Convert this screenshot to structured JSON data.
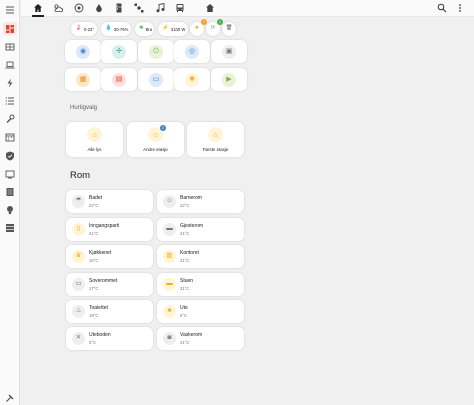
{
  "colors": {
    "accent": "#db4437",
    "sidebar_active_bg": "#fde3e1",
    "light_yellow": "#fff4d5",
    "icon_yellow": "#f0ad16",
    "grey_circle": "#eeeeee",
    "badge_blue": "#3f83c7",
    "badge_orange": "#f0a030",
    "badge_green": "#4caf50"
  },
  "sidebar": {
    "items": [
      {
        "icon": "menu-icon"
      },
      {
        "icon": "dashboard-icon"
      },
      {
        "icon": "grid-icon"
      },
      {
        "icon": "laptop-icon"
      },
      {
        "icon": "flash-icon"
      },
      {
        "icon": "list-icon"
      },
      {
        "icon": "wrench-icon"
      },
      {
        "icon": "calendar-icon"
      },
      {
        "icon": "shield-icon"
      },
      {
        "icon": "tv-icon"
      },
      {
        "icon": "storage-icon"
      },
      {
        "icon": "bulb-icon"
      },
      {
        "icon": "server-icon"
      },
      {
        "icon": "hammer-icon"
      }
    ]
  },
  "topbar": {
    "tabs": [
      {
        "icon": "home-icon",
        "active": true
      },
      {
        "icon": "weather-icon"
      },
      {
        "icon": "robot-icon"
      },
      {
        "icon": "water-drop-icon"
      },
      {
        "icon": "fridge-icon"
      },
      {
        "icon": "satellite-icon"
      },
      {
        "icon": "music-icon"
      },
      {
        "icon": "bus-icon"
      },
      {
        "icon": "house-outline-icon"
      }
    ],
    "actions": [
      {
        "icon": "search-icon"
      },
      {
        "icon": "more-vert-icon"
      }
    ]
  },
  "status": {
    "temperature": "0-23°",
    "humidity": "30-76%",
    "status_text": "Bra",
    "power": "3100 W",
    "badge_one": "7",
    "badge_two": "1"
  },
  "tiles": [
    {
      "icon": "thermostat-icon"
    },
    {
      "icon": "fan-icon"
    },
    {
      "icon": "plug-icon"
    },
    {
      "icon": "robot-vacuum-icon"
    },
    {
      "icon": "washer-icon"
    },
    {
      "icon": "heater-icon"
    },
    {
      "icon": "tv-box-icon"
    },
    {
      "icon": "car-icon"
    },
    {
      "icon": "lamp-icon"
    },
    {
      "icon": "camera-icon"
    }
  ],
  "quick": {
    "label": "Hurtigvalg",
    "items": [
      {
        "label": "Alle lys",
        "icon": "home-lights-icon"
      },
      {
        "label": "Andre etasje",
        "icon": "home-floor-icon",
        "badge": "2"
      },
      {
        "label": "Første etasje",
        "icon": "home-floor-icon"
      }
    ]
  },
  "rooms": {
    "title": "Rom",
    "items": [
      {
        "name": "Badet",
        "temp": "22°C",
        "icon": "shower-icon",
        "active": false
      },
      {
        "name": "Barnerom",
        "temp": "22°C",
        "icon": "teddy-icon",
        "active": false
      },
      {
        "name": "Inngangsparti",
        "temp": "21°C",
        "icon": "door-icon",
        "active": true
      },
      {
        "name": "Gjesterom",
        "temp": "21°C",
        "icon": "bed-icon",
        "active": false
      },
      {
        "name": "Kjøkkenet",
        "temp": "19°C",
        "icon": "chef-hat-icon",
        "active": true
      },
      {
        "name": "Kontoret",
        "temp": "21°C",
        "icon": "office-icon",
        "active": true
      },
      {
        "name": "Soverommet",
        "temp": "17°C",
        "icon": "bed-double-icon",
        "active": false
      },
      {
        "name": "Stuen",
        "temp": "21°C",
        "icon": "sofa-icon",
        "active": true
      },
      {
        "name": "Toalettet",
        "temp": "19°C",
        "icon": "toilet-icon",
        "active": false
      },
      {
        "name": "Ute",
        "temp": "5°C",
        "icon": "tree-icon",
        "active": true
      },
      {
        "name": "Uteboden",
        "temp": "0°C",
        "icon": "tools-icon",
        "active": false
      },
      {
        "name": "Vaskerom",
        "temp": "21°C",
        "icon": "washing-machine-icon",
        "active": false
      }
    ]
  }
}
